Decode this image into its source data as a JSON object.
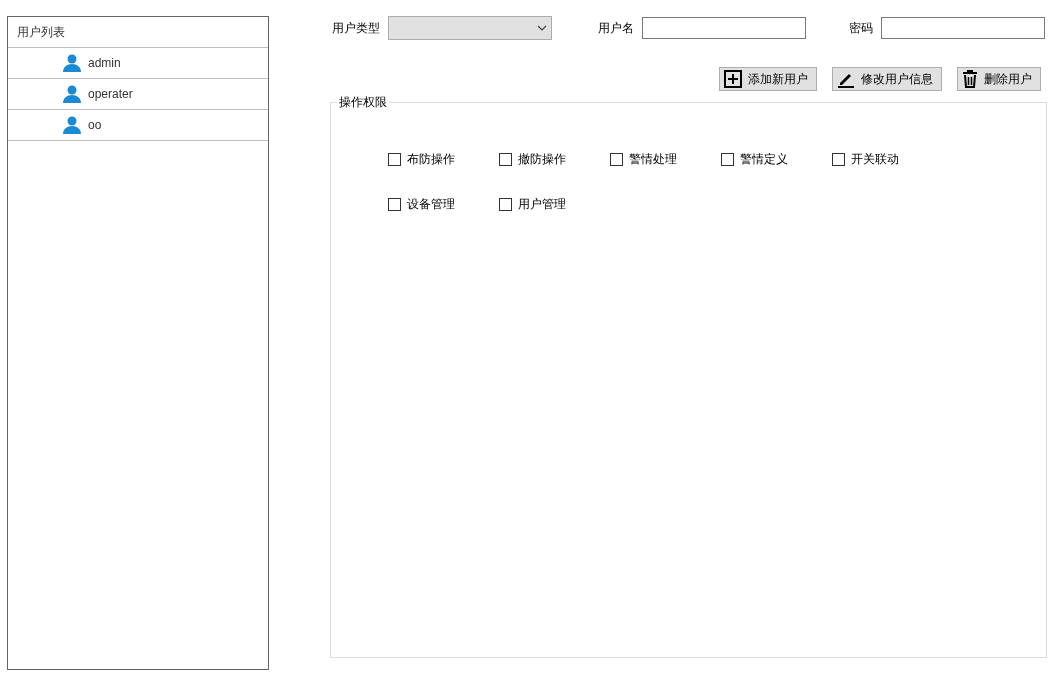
{
  "user_list": {
    "title": "用户列表",
    "users": [
      {
        "name": "admin"
      },
      {
        "name": "operater"
      },
      {
        "name": "oo"
      }
    ]
  },
  "form": {
    "user_type_label": "用户类型",
    "username_label": "用户名",
    "password_label": "密码"
  },
  "buttons": [
    {
      "kind": "add",
      "label": "添加新用户"
    },
    {
      "kind": "edit",
      "label": "修改用户信息"
    },
    {
      "kind": "delete",
      "label": "删除用户"
    }
  ],
  "permissions": {
    "title": "操作权限",
    "items": [
      {
        "label": "布防操作",
        "checked": false
      },
      {
        "label": "撤防操作",
        "checked": false
      },
      {
        "label": "警情处理",
        "checked": false
      },
      {
        "label": "警情定义",
        "checked": false
      },
      {
        "label": "开关联动",
        "checked": false
      },
      {
        "label": "设备管理",
        "checked": false
      },
      {
        "label": "用户管理",
        "checked": false
      }
    ]
  }
}
